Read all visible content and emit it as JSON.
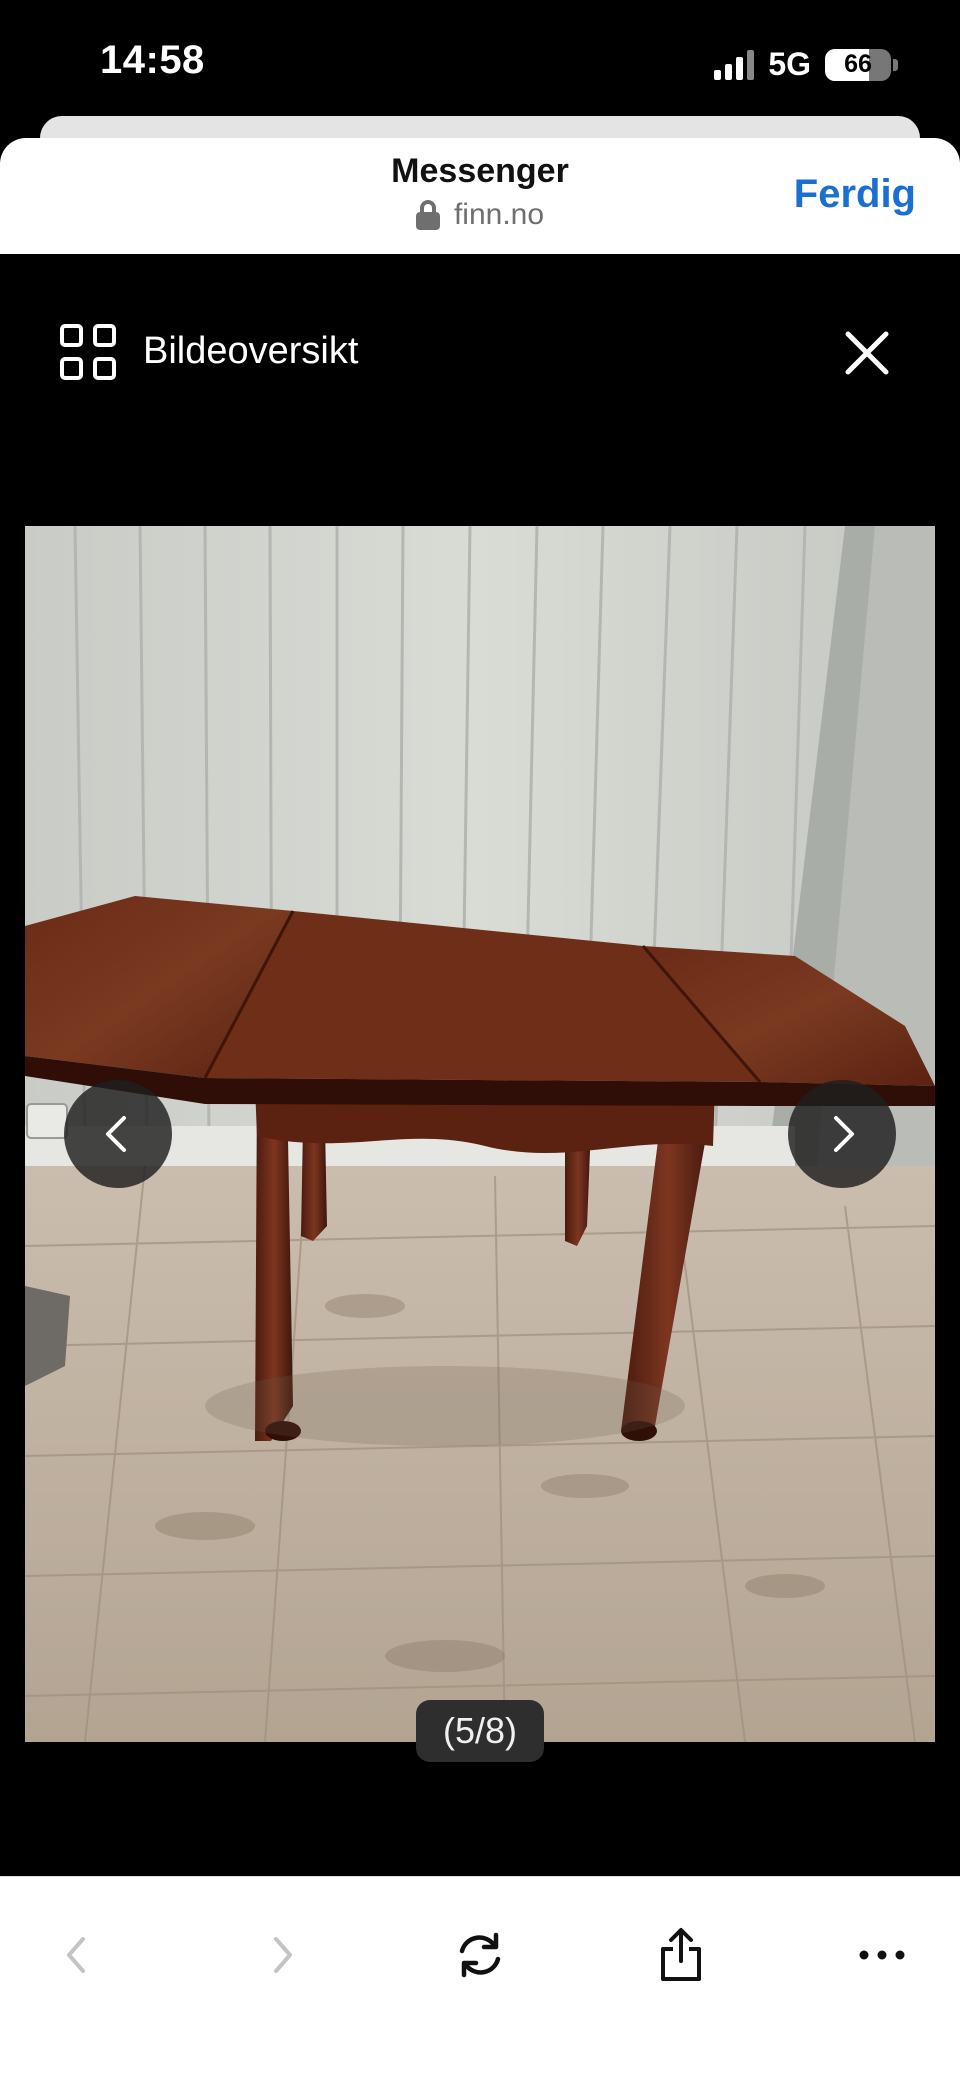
{
  "status_bar": {
    "time": "14:58",
    "network": "5G",
    "battery": "66",
    "battery_level": 0.66
  },
  "browser": {
    "title": "Messenger",
    "domain": "finn.no",
    "done_label": "Ferdig",
    "accent_color": "#1a6fd0"
  },
  "gallery": {
    "overview_label": "Bildeoversikt",
    "counter": "(5/8)",
    "image_subject": "drop-leaf wooden table"
  },
  "icons": {
    "grid": "grid-icon",
    "close": "close-icon",
    "prev": "chevron-left-icon",
    "next": "chevron-right-icon",
    "back": "back-icon",
    "forward": "forward-icon",
    "reload": "reload-icon",
    "share": "share-icon",
    "more": "more-icon",
    "lock": "lock-icon"
  }
}
